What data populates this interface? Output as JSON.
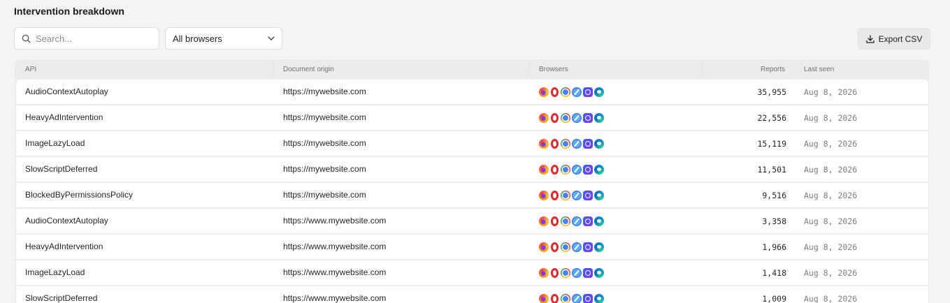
{
  "title": "Intervention breakdown",
  "search": {
    "placeholder": "Search..."
  },
  "browser_filter": {
    "selected": "All browsers"
  },
  "export_label": "Export CSV",
  "columns": {
    "api": "API",
    "origin": "Document origin",
    "browsers": "Browsers",
    "reports": "Reports",
    "last_seen": "Last seen"
  },
  "browser_icons": [
    "firefox-icon",
    "opera-icon",
    "chrome-icon",
    "safari-icon",
    "arc-icon",
    "edge-icon"
  ],
  "rows": [
    {
      "api": "AudioContextAutoplay",
      "origin": "https://mywebsite.com",
      "reports": "35,955",
      "last_seen": "Aug 8, 2026"
    },
    {
      "api": "HeavyAdIntervention",
      "origin": "https://mywebsite.com",
      "reports": "22,556",
      "last_seen": "Aug 8, 2026"
    },
    {
      "api": "ImageLazyLoad",
      "origin": "https://mywebsite.com",
      "reports": "15,119",
      "last_seen": "Aug 8, 2026"
    },
    {
      "api": "SlowScriptDeferred",
      "origin": "https://mywebsite.com",
      "reports": "11,501",
      "last_seen": "Aug 8, 2026"
    },
    {
      "api": "BlockedByPermissionsPolicy",
      "origin": "https://mywebsite.com",
      "reports": "9,516",
      "last_seen": "Aug 8, 2026"
    },
    {
      "api": "AudioContextAutoplay",
      "origin": "https://www.mywebsite.com",
      "reports": "3,358",
      "last_seen": "Aug 8, 2026"
    },
    {
      "api": "HeavyAdIntervention",
      "origin": "https://www.mywebsite.com",
      "reports": "1,966",
      "last_seen": "Aug 8, 2026"
    },
    {
      "api": "ImageLazyLoad",
      "origin": "https://www.mywebsite.com",
      "reports": "1,418",
      "last_seen": "Aug 8, 2026"
    },
    {
      "api": "SlowScriptDeferred",
      "origin": "https://www.mywebsite.com",
      "reports": "1,009",
      "last_seen": "Aug 8, 2026"
    }
  ]
}
